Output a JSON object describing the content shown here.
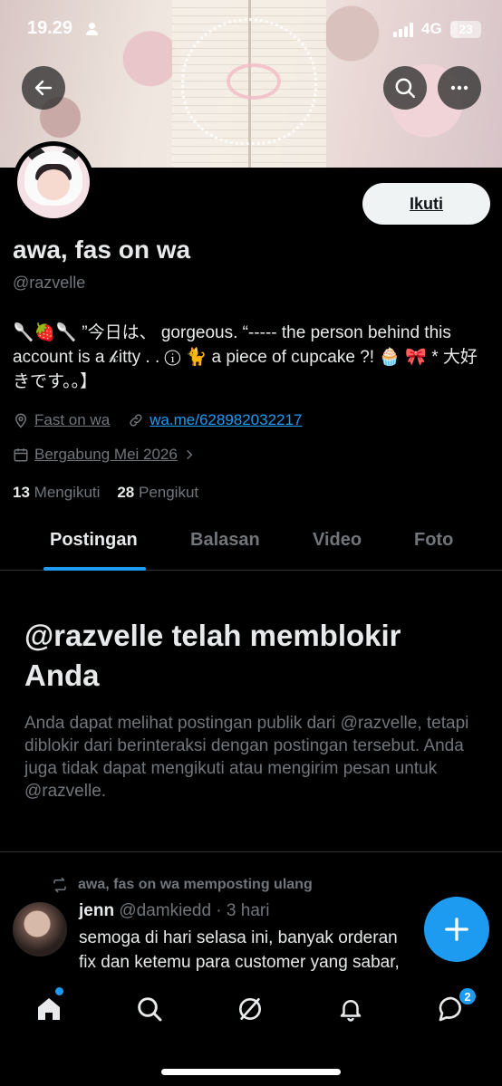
{
  "status_bar": {
    "time": "19.29",
    "network": "4G",
    "battery": "23",
    "battery_percent": 23
  },
  "profile": {
    "display_name": "awa, fas on wa",
    "handle": "@razvelle",
    "follow_button": "Ikuti",
    "bio": "🥄🍓🥄 ”今日は、 gorgeous. “----- the person behind this account is a 𝓀itty . . ⓘ 🐈 a piece of cupcake ?! 🧁 🎀 * 大好きです。。】",
    "location": "Fast on wa",
    "website": "wa.me/628982032217",
    "joined": "Bergabung Mei 2026",
    "following_count": "13",
    "following_label": "Mengikuti",
    "followers_count": "28",
    "followers_label": "Pengikut"
  },
  "tabs": [
    "Postingan",
    "Balasan",
    "Video",
    "Foto"
  ],
  "blocked": {
    "title": "@razvelle telah memblokir Anda",
    "message": "Anda dapat melihat postingan publik dari @razvelle, tetapi diblokir dari berinteraksi dengan postingan tersebut. Anda juga tidak dapat mengikuti atau mengirim pesan untuk @razvelle."
  },
  "post": {
    "repost_label": "awa, fas on wa memposting ulang",
    "author_name": "jenn",
    "author_handle": "@damkiedd",
    "time": "· 3 hari",
    "text_line1": "semoga di hari selasa ini, banyak orderan",
    "text_line2": "fix dan ketemu para customer yang sabar,"
  },
  "nav": {
    "messages_badge": "2"
  },
  "colors": {
    "accent": "#1d9bf0",
    "background": "#000000",
    "muted": "#71767b",
    "text": "#e7e9ea"
  }
}
